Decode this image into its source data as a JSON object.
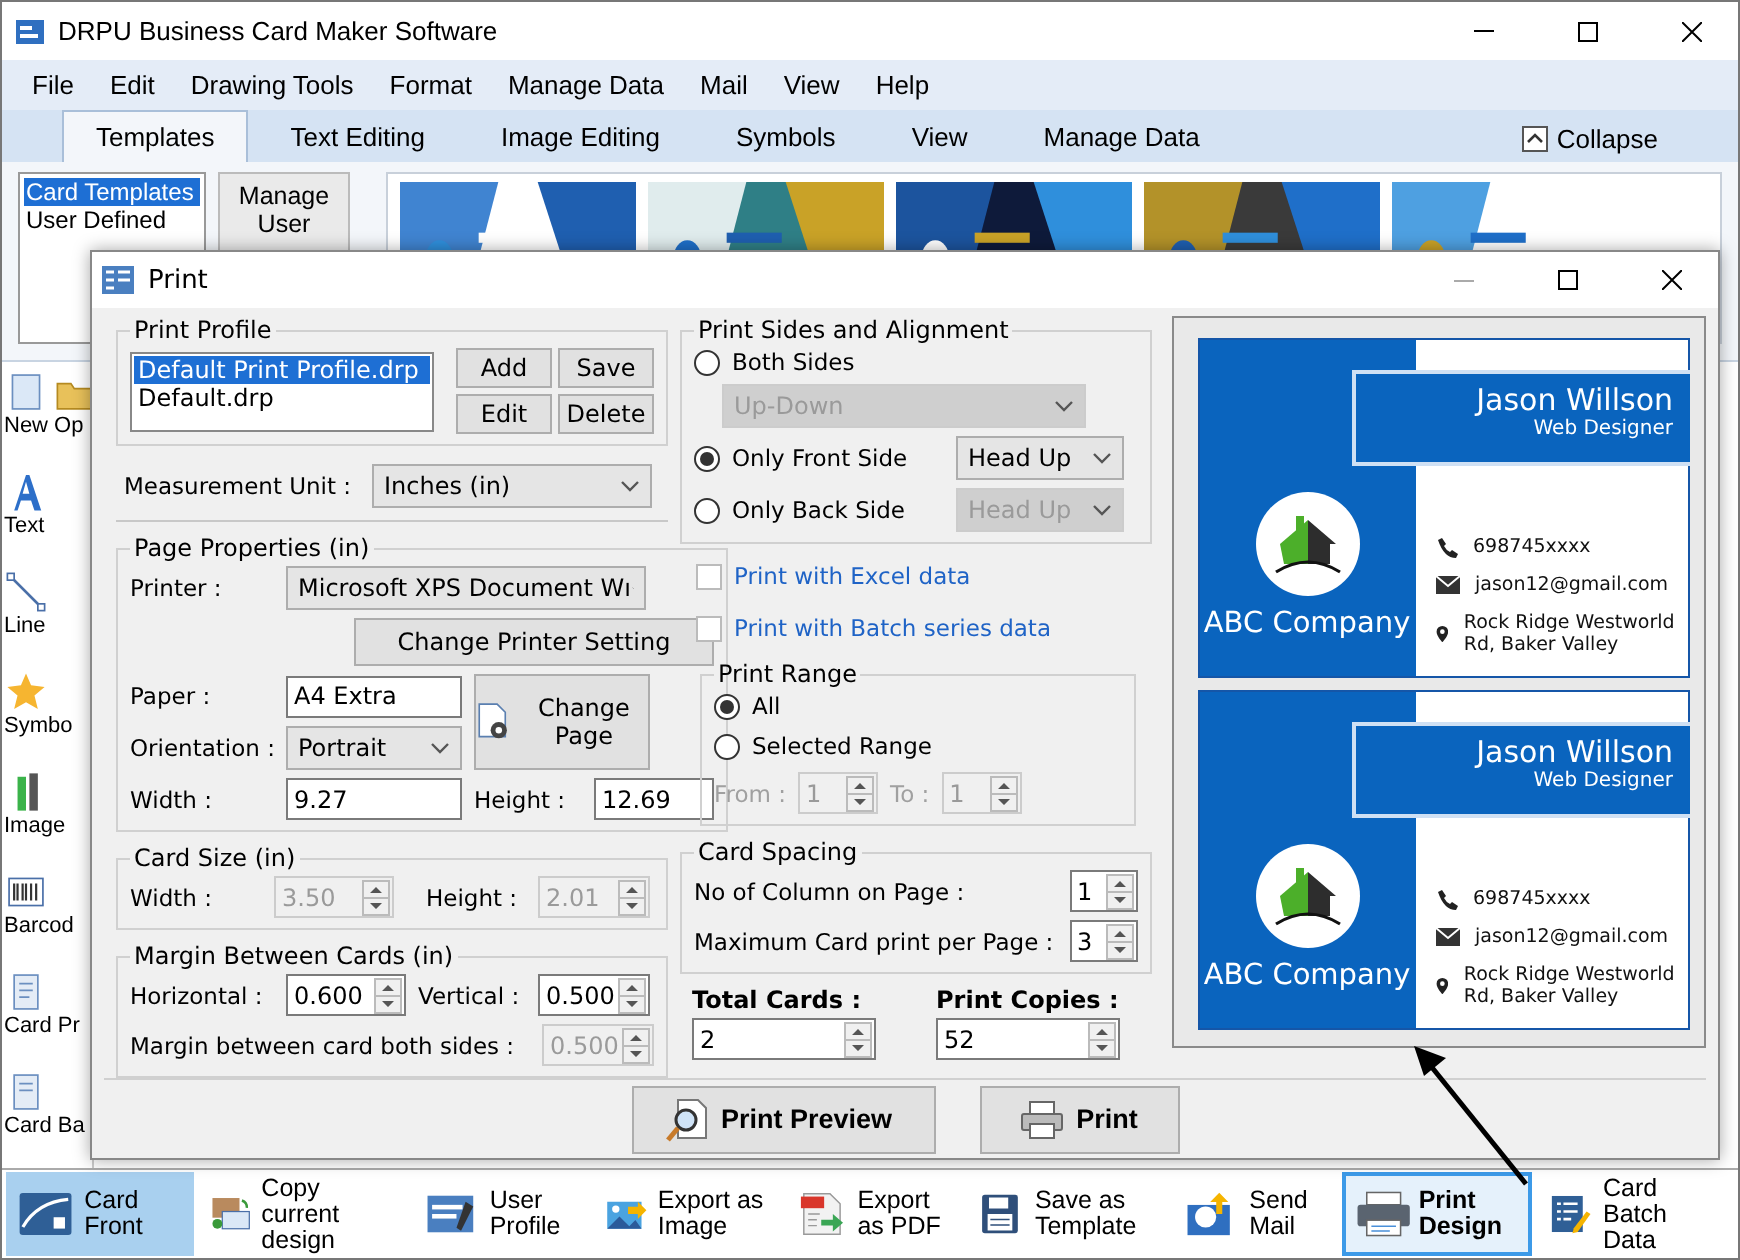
{
  "window": {
    "title": "DRPU Business Card Maker Software"
  },
  "menu": [
    "File",
    "Edit",
    "Drawing Tools",
    "Format",
    "Manage Data",
    "Mail",
    "View",
    "Help"
  ],
  "ribbon_tabs": [
    {
      "label": "Templates",
      "selected": true
    },
    {
      "label": "Text Editing",
      "selected": false
    },
    {
      "label": "Image Editing",
      "selected": false
    },
    {
      "label": "Symbols",
      "selected": false
    },
    {
      "label": "View",
      "selected": false
    },
    {
      "label": "Manage Data",
      "selected": false
    }
  ],
  "collapse_button": "Collapse",
  "template_list": [
    {
      "label": "Card Templates",
      "selected": true
    },
    {
      "label": "User Defined",
      "selected": false
    }
  ],
  "manage_button": "Manage User",
  "template_thumbnails": [
    {
      "kind": "picture"
    },
    {
      "kind": "picture"
    },
    {
      "kind": "picture"
    },
    {
      "kind": "picture"
    },
    {
      "kind": "picture"
    }
  ],
  "tools": [
    "New",
    "Op",
    "Text",
    "Line",
    "Symbo",
    "Image",
    "Barcod",
    "Card Pr",
    "Card Ba"
  ],
  "dialog": {
    "title": "Print",
    "print_profile": {
      "legend": "Print Profile",
      "items": [
        {
          "label": "Default Print Profile.drp",
          "selected": true
        },
        {
          "label": "Default.drp",
          "selected": false
        }
      ],
      "buttons": [
        "Add",
        "Save",
        "Edit",
        "Delete"
      ]
    },
    "measurement_unit": {
      "label": "Measurement Unit :",
      "value": "Inches (in)"
    },
    "page_properties": {
      "legend": "Page Properties (in)",
      "printer_label": "Printer :",
      "printer_value": "Microsoft XPS Document Wı",
      "change_printer_button": "Change Printer Setting",
      "paper_label": "Paper :",
      "paper_value": "A4 Extra",
      "orientation_label": "Orientation :",
      "orientation_value": "Portrait",
      "change_page_button": "Change Page",
      "width_label": "Width :",
      "width_value": "9.27",
      "height_label": "Height :",
      "height_value": "12.69"
    },
    "card_size": {
      "legend": "Card Size (in)",
      "width_label": "Width :",
      "width_value": "3.50",
      "height_label": "Height :",
      "height_value": "2.01",
      "disabled": true
    },
    "margin": {
      "legend": "Margin Between Cards (in)",
      "horizontal_label": "Horizontal :",
      "horizontal_value": "0.600",
      "vertical_label": "Vertical :",
      "vertical_value": "0.500",
      "both_label": "Margin between card both sides :",
      "both_value": "0.500",
      "both_disabled": true
    },
    "print_sides": {
      "legend": "Print Sides and Alignment",
      "options": [
        {
          "label": "Both Sides",
          "selected": false,
          "select_value": "Up-Down",
          "select_disabled": true
        },
        {
          "label": "Only Front Side",
          "selected": true,
          "select_value": "Head Up",
          "select_disabled": false
        },
        {
          "label": "Only Back Side",
          "selected": false,
          "select_value": "Head Up",
          "select_disabled": true
        }
      ]
    },
    "data_options": [
      {
        "label": "Print with Excel data",
        "checked": false
      },
      {
        "label": "Print with Batch series data",
        "checked": false
      }
    ],
    "print_range": {
      "legend": "Print Range",
      "options": [
        {
          "label": "All",
          "selected": true
        },
        {
          "label": "Selected Range",
          "selected": false
        }
      ],
      "from_label": "From :",
      "from_value": "1",
      "to_label": "To :",
      "to_value": "1",
      "disabled": true
    },
    "card_spacing": {
      "legend": "Card Spacing",
      "rows": [
        {
          "label": "No of Column on Page :",
          "value": "1"
        },
        {
          "label": "Maximum Card print per Page :",
          "value": "3"
        }
      ]
    },
    "total_cards": {
      "label": "Total Cards :",
      "value": "2"
    },
    "print_copies": {
      "label": "Print Copies :",
      "value": "52"
    },
    "preview_cards": [
      {
        "name": "Jason Willson",
        "title": "Web Designer",
        "company": "ABC Company",
        "phone": "698745xxxx",
        "email": "jason12@gmail.com",
        "address": "Rock Ridge Westworld Rd, Baker Valley"
      },
      {
        "name": "Jason Willson",
        "title": "Web Designer",
        "company": "ABC Company",
        "phone": "698745xxxx",
        "email": "jason12@gmail.com",
        "address": "Rock Ridge Westworld Rd, Baker Valley"
      }
    ],
    "buttons": [
      "Print Preview",
      "Print"
    ]
  },
  "taskbar": [
    {
      "label": "Card Front",
      "selected": true,
      "highlighted": false
    },
    {
      "label": "Copy current design",
      "selected": false,
      "highlighted": false
    },
    {
      "label": "User Profile",
      "selected": false,
      "highlighted": false
    },
    {
      "label": "Export as Image",
      "selected": false,
      "highlighted": false
    },
    {
      "label": "Export as PDF",
      "selected": false,
      "highlighted": false
    },
    {
      "label": "Save as Template",
      "selected": false,
      "highlighted": false
    },
    {
      "label": "Send Mail",
      "selected": false,
      "highlighted": false
    },
    {
      "label": "Print Design",
      "selected": false,
      "highlighted": true
    },
    {
      "label": "Card Batch Data",
      "selected": false,
      "highlighted": false
    }
  ]
}
